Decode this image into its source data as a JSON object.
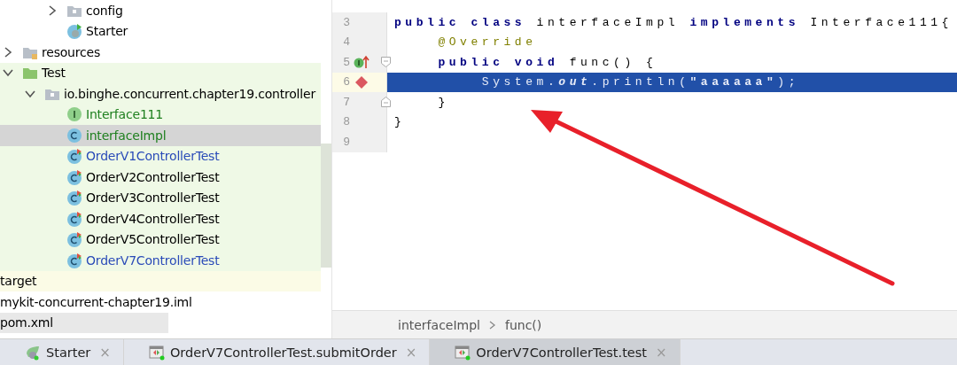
{
  "project_tree": {
    "clipped_above": [
      {
        "label": "config",
        "kind": "package",
        "expanded": false,
        "color": "#000000",
        "selected": false,
        "test_source": false,
        "excluded": false,
        "hovered": false
      },
      {
        "label": "Starter",
        "kind": "app-class",
        "color": "#000000",
        "selected": false,
        "test_source": false,
        "excluded": false,
        "hovered": false
      }
    ],
    "items": [
      {
        "label": "resources",
        "kind": "resources",
        "expanded": false,
        "color": "#000000",
        "selected": false,
        "test_source": false,
        "excluded": false,
        "hovered": false
      },
      {
        "label": "Test",
        "kind": "folder",
        "expanded": true,
        "color": "#000000",
        "selected": false,
        "test_source": true,
        "excluded": false,
        "hovered": false,
        "children": [
          {
            "label": "io.binghe.concurrent.chapter19.controller",
            "kind": "package",
            "expanded": true,
            "color": "#000000",
            "selected": false,
            "test_source": true,
            "excluded": false,
            "hovered": false,
            "children": [
              {
                "label": "Interface111",
                "kind": "interface",
                "color": "#208020",
                "selected": false,
                "test_source": true,
                "excluded": false,
                "hovered": false
              },
              {
                "label": "interfaceImpl",
                "kind": "class",
                "color": "#208020",
                "selected": true,
                "test_source": true,
                "excluded": false,
                "hovered": false
              },
              {
                "label": "OrderV1ControllerTest",
                "kind": "test-class",
                "color": "#2a4bb8",
                "selected": false,
                "test_source": true,
                "excluded": false,
                "hovered": false
              },
              {
                "label": "OrderV2ControllerTest",
                "kind": "test-class",
                "color": "#000000",
                "selected": false,
                "test_source": true,
                "excluded": false,
                "hovered": false
              },
              {
                "label": "OrderV3ControllerTest",
                "kind": "test-class",
                "color": "#000000",
                "selected": false,
                "test_source": true,
                "excluded": false,
                "hovered": false
              },
              {
                "label": "OrderV4ControllerTest",
                "kind": "test-class",
                "color": "#000000",
                "selected": false,
                "test_source": true,
                "excluded": false,
                "hovered": false
              },
              {
                "label": "OrderV5ControllerTest",
                "kind": "test-class",
                "color": "#000000",
                "selected": false,
                "test_source": true,
                "excluded": false,
                "hovered": false
              },
              {
                "label": "OrderV7ControllerTest",
                "kind": "test-class",
                "color": "#2a4bb8",
                "selected": false,
                "test_source": true,
                "excluded": false,
                "hovered": false
              }
            ]
          }
        ]
      },
      {
        "label": "target",
        "kind": "plain",
        "color": "#000000",
        "selected": false,
        "test_source": false,
        "excluded": true,
        "hovered": false
      },
      {
        "label": "mykit-concurrent-chapter19.iml",
        "kind": "plain",
        "color": "#000000",
        "selected": false,
        "test_source": false,
        "excluded": false,
        "hovered": false
      },
      {
        "label": "pom.xml",
        "kind": "plain",
        "color": "#000000",
        "selected": false,
        "test_source": false,
        "excluded": false,
        "hovered": true
      }
    ]
  },
  "editor": {
    "lines": [
      {
        "number": "3",
        "selected": false,
        "implements_marker": false,
        "breakpoint": false,
        "fold_start": false,
        "fold_end": false,
        "tokens": [
          {
            "kind": "keyword",
            "text": "public class "
          },
          {
            "kind": "plain",
            "text": "interfaceImpl "
          },
          {
            "kind": "keyword",
            "text": "implements "
          },
          {
            "kind": "plain",
            "text": "Interface111{"
          }
        ]
      },
      {
        "number": "4",
        "selected": false,
        "implements_marker": false,
        "breakpoint": false,
        "fold_start": false,
        "fold_end": false,
        "tokens": [
          {
            "kind": "annotation",
            "text": "    @Override"
          }
        ]
      },
      {
        "number": "5",
        "selected": false,
        "implements_marker": true,
        "breakpoint": false,
        "fold_start": true,
        "fold_end": false,
        "tokens": [
          {
            "kind": "keyword",
            "text": "    public void "
          },
          {
            "kind": "plain",
            "text": "func() {"
          }
        ]
      },
      {
        "number": "6",
        "selected": true,
        "implements_marker": false,
        "breakpoint": true,
        "fold_start": false,
        "fold_end": false,
        "tokens": [
          {
            "kind": "plain",
            "text": "        System."
          },
          {
            "kind": "static",
            "text": "out"
          },
          {
            "kind": "plain",
            "text": ".println("
          },
          {
            "kind": "string",
            "text": "\"aaaaaa\""
          },
          {
            "kind": "plain",
            "text": ");"
          }
        ]
      },
      {
        "number": "7",
        "selected": false,
        "implements_marker": false,
        "breakpoint": false,
        "fold_start": false,
        "fold_end": true,
        "tokens": [
          {
            "kind": "plain",
            "text": "    }"
          }
        ]
      },
      {
        "number": "8",
        "selected": false,
        "implements_marker": false,
        "breakpoint": false,
        "fold_start": false,
        "fold_end": false,
        "tokens": [
          {
            "kind": "plain",
            "text": "}"
          }
        ]
      },
      {
        "number": "9",
        "selected": false,
        "implements_marker": false,
        "breakpoint": false,
        "fold_start": false,
        "fold_end": false
      }
    ],
    "breadcrumbs": [
      "interfaceImpl",
      "func()"
    ]
  },
  "run_tabs": [
    {
      "label": "Starter",
      "kind": "app",
      "close": "×",
      "selected": false
    },
    {
      "label": "OrderV7ControllerTest.submitOrder",
      "kind": "test",
      "close": "×",
      "selected": false
    },
    {
      "label": "OrderV7ControllerTest.test",
      "kind": "test",
      "close": "×",
      "selected": true
    }
  ]
}
